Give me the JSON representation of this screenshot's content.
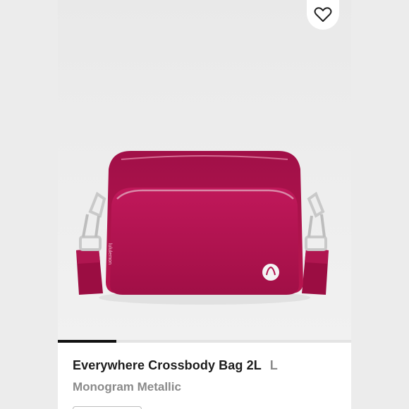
{
  "product": {
    "title": "Everywhere Crossbody Bag 2L",
    "size": "L",
    "subtitle": "Monogram Metallic",
    "color": "#b3134e"
  },
  "carousel": {
    "current_image": 1,
    "progress_fraction": 0.2
  },
  "icons": {
    "like": "heart-outline-icon"
  }
}
